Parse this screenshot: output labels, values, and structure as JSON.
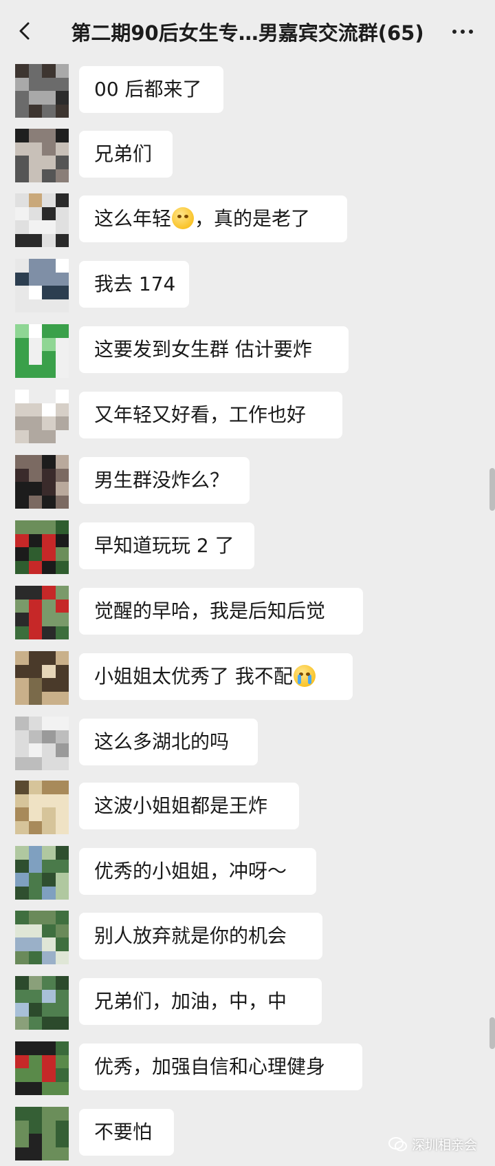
{
  "header": {
    "back_icon": "chevron-left-icon",
    "title": "第二期90后女生专…男嘉宾交流群(65)",
    "more_icon": "more-dots-icon"
  },
  "messages": [
    {
      "text": "00 后都来了"
    },
    {
      "text": "兄弟们"
    },
    {
      "text_before": "这么年轻",
      "emoji": "sob-smile-emoji",
      "text_after": "，真的是老了"
    },
    {
      "text": "我去 174"
    },
    {
      "text": "这要发到女生群 估计要炸"
    },
    {
      "text": "又年轻又好看，工作也好"
    },
    {
      "text": "男生群没炸么？"
    },
    {
      "text": "早知道玩玩 2 了"
    },
    {
      "text": "觉醒的早哈，我是后知后觉"
    },
    {
      "text_before": "小姐姐太优秀了 我不配",
      "emoji": "crying-emoji",
      "text_after": ""
    },
    {
      "text": "这么多湖北的吗"
    },
    {
      "text": "这波小姐姐都是王炸"
    },
    {
      "text": "优秀的小姐姐，冲呀～"
    },
    {
      "text": "别人放弃就是你的机会"
    },
    {
      "text": "兄弟们，加油，中，中"
    },
    {
      "text": "优秀，加强自信和心理健身"
    },
    {
      "text": "不要怕"
    }
  ],
  "watermark": {
    "icon": "wechat-icon",
    "text": "深圳相亲会"
  },
  "colors": {
    "background": "#ededed",
    "bubble": "#ffffff",
    "text": "#1a1a1a"
  }
}
